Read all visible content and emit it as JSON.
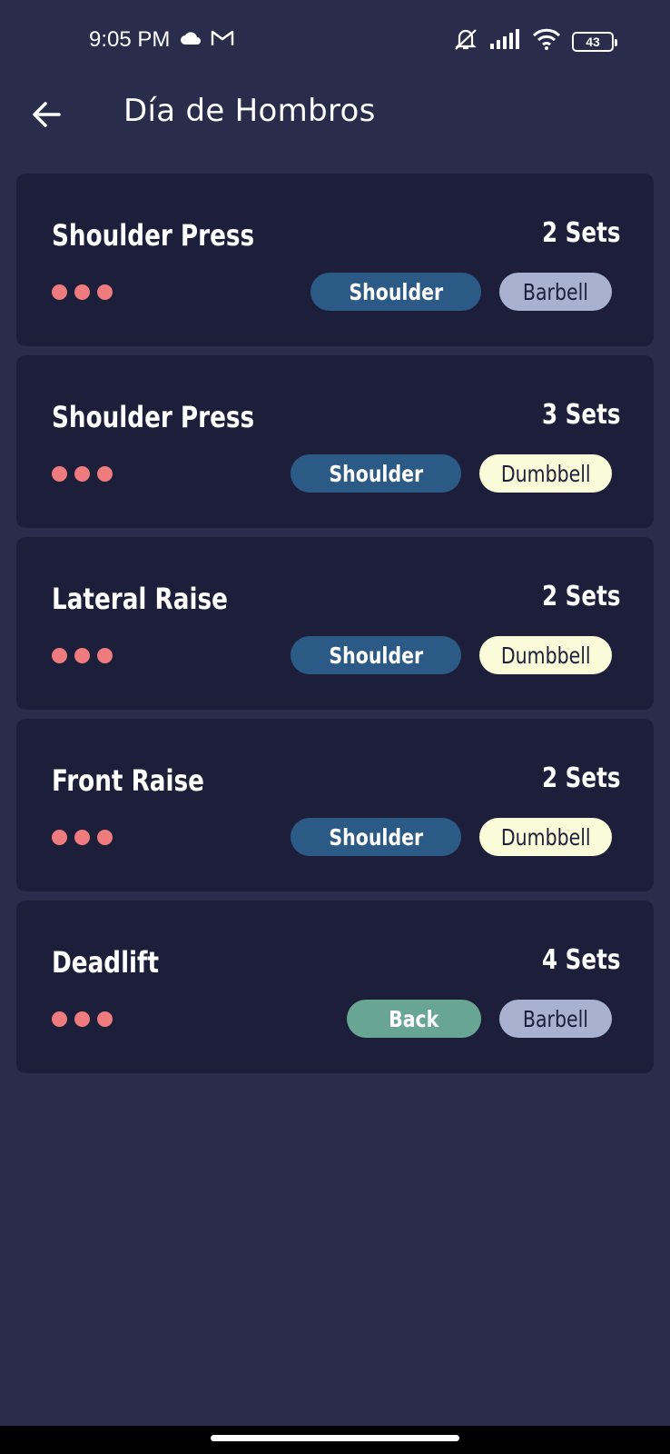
{
  "status_bar": {
    "time": "9:05 PM",
    "battery": "43",
    "icons": [
      "cloud-icon",
      "gmail-icon",
      "silent-icon",
      "signal-icon",
      "wifi-icon",
      "battery-icon"
    ]
  },
  "header": {
    "title": "Día de Hombros",
    "back_icon": "arrow-left-icon"
  },
  "colors": {
    "background": "#292c4b",
    "card": "#1d1f3a",
    "dot": "#ee7b7d",
    "shoulder_tag": "#2c5a86",
    "back_tag": "#69a593",
    "barbell_tag": "#a8b1cf",
    "dumbbell_tag": "#fafcd9"
  },
  "exercises": [
    {
      "name": "Shoulder Press",
      "sets": "2 Sets",
      "muscle": "Shoulder",
      "equipment": "Barbell"
    },
    {
      "name": "Shoulder Press",
      "sets": "3 Sets",
      "muscle": "Shoulder",
      "equipment": "Dumbbell"
    },
    {
      "name": "Lateral Raise",
      "sets": "2 Sets",
      "muscle": "Shoulder",
      "equipment": "Dumbbell"
    },
    {
      "name": "Front Raise",
      "sets": "2 Sets",
      "muscle": "Shoulder",
      "equipment": "Dumbbell"
    },
    {
      "name": "Deadlift",
      "sets": "4 Sets",
      "muscle": "Back",
      "equipment": "Barbell"
    }
  ]
}
